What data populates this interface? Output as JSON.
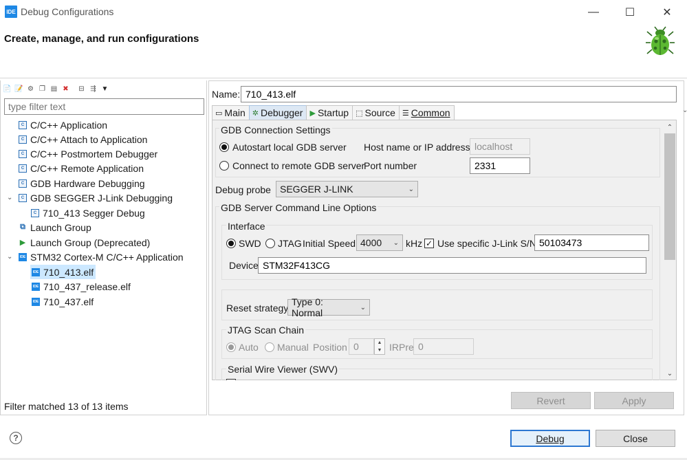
{
  "window": {
    "logo_text": "IDE",
    "title": "Debug Configurations",
    "minimize": "—",
    "maximize": "☐",
    "close": "✕"
  },
  "header": {
    "title": "Create, manage, and run configurations"
  },
  "left": {
    "filter_placeholder": "type filter text",
    "tree": [
      {
        "label": "C/C++ Application",
        "icon": "c-app-icon",
        "level": 0
      },
      {
        "label": "C/C++ Attach to Application",
        "icon": "c-app-icon",
        "level": 0
      },
      {
        "label": "C/C++ Postmortem Debugger",
        "icon": "c-app-icon",
        "level": 0
      },
      {
        "label": "C/C++ Remote Application",
        "icon": "c-app-icon",
        "level": 0
      },
      {
        "label": "GDB Hardware Debugging",
        "icon": "c-app-icon",
        "level": 0
      },
      {
        "label": "GDB SEGGER J-Link Debugging",
        "icon": "c-app-icon",
        "level": 0,
        "expanded": true
      },
      {
        "label": "710_413 Segger Debug",
        "icon": "c-app-icon",
        "level": 1
      },
      {
        "label": "Launch Group",
        "icon": "launch-group-icon",
        "level": 0
      },
      {
        "label": "Launch Group (Deprecated)",
        "icon": "launch-icon",
        "level": 0
      },
      {
        "label": "STM32 Cortex-M C/C++ Application",
        "icon": "ide-icon",
        "level": 0,
        "expanded": true
      },
      {
        "label": "710_413.elf",
        "icon": "ide-icon",
        "level": 1,
        "selected": true
      },
      {
        "label": "710_437_release.elf",
        "icon": "ide-icon",
        "level": 1
      },
      {
        "label": "710_437.elf",
        "icon": "ide-icon",
        "level": 1
      }
    ],
    "status": "Filter matched 13 of 13 items"
  },
  "right": {
    "name_label": "Name:",
    "name_value": "710_413.elf",
    "tabs": [
      {
        "label": "Main",
        "icon": "▭"
      },
      {
        "label": "Debugger",
        "icon": "✲"
      },
      {
        "label": "Startup",
        "icon": "▶"
      },
      {
        "label": "Source",
        "icon": "⬚"
      },
      {
        "label": "Common",
        "icon": "☰"
      }
    ],
    "gdb_conn": {
      "title": "GDB Connection Settings",
      "autostart": "Autostart local GDB server",
      "connect_remote": "Connect to remote GDB server",
      "host_label": "Host name or IP address",
      "host_value": "localhost",
      "port_label": "Port number",
      "port_value": "2331"
    },
    "probe_label": "Debug probe",
    "probe_value": "SEGGER J-LINK",
    "server_opts_title": "GDB Server Command Line Options",
    "interface": {
      "title": "Interface",
      "swd": "SWD",
      "jtag": "JTAG",
      "speed_label": "Initial Speed",
      "speed_value": "4000",
      "khz": "kHz",
      "use_sn": "Use specific J-Link S/N",
      "sn_value": "50103473",
      "device_label": "Device",
      "device_value": "STM32F413CG"
    },
    "reset_label": "Reset strategy",
    "reset_value": "Type 0: Normal",
    "jtag_chain": {
      "title": "JTAG Scan Chain",
      "auto": "Auto",
      "manual": "Manual",
      "position_label": "Position",
      "position_value": "0",
      "irpre_label": "IRPre",
      "irpre_value": "0"
    },
    "swv_title": "Serial Wire Viewer (SWV)",
    "revert": "Revert",
    "apply": "Apply"
  },
  "footer": {
    "help": "?",
    "debug": "Debug",
    "close": "Close"
  },
  "colors": {
    "accent": "#2c77d1",
    "selection": "#cce8ff",
    "ide_blue": "#1e88e5"
  }
}
